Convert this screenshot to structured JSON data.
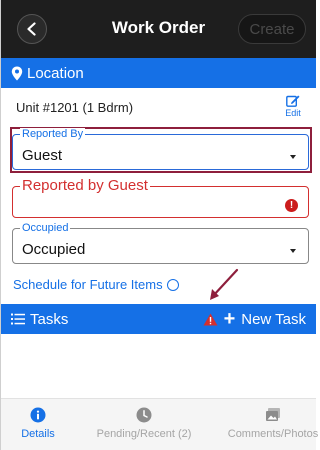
{
  "header": {
    "title": "Work Order",
    "create_label": "Create",
    "back_icon": "chevron-left-icon"
  },
  "location": {
    "label": "Location",
    "icon": "map-pin-icon",
    "unit": "Unit #1201 (1 Bdrm)",
    "edit_label": "Edit"
  },
  "reported_by": {
    "label": "Reported By",
    "value": "Guest"
  },
  "reported_by_guest": {
    "label": "Reported by Guest",
    "value": "",
    "error_icon": "alert-circle-icon"
  },
  "occupied": {
    "label": "Occupied",
    "value": "Occupied"
  },
  "schedule": {
    "label": "Schedule for Future Items"
  },
  "tasks": {
    "label": "Tasks",
    "new_task_label": "New Task",
    "warning_icon": "warning-triangle-icon"
  },
  "tabs": [
    {
      "label": "Details",
      "icon": "info-icon",
      "active": true
    },
    {
      "label": "Pending/Recent (2)",
      "icon": "clock-icon",
      "active": false
    },
    {
      "label": "Comments/Photos",
      "icon": "photos-icon",
      "active": false
    }
  ],
  "colors": {
    "accent": "#1570e6",
    "header_bg": "#1e1e1e",
    "error": "#d32f2f",
    "annotation": "#8e1f3c"
  }
}
